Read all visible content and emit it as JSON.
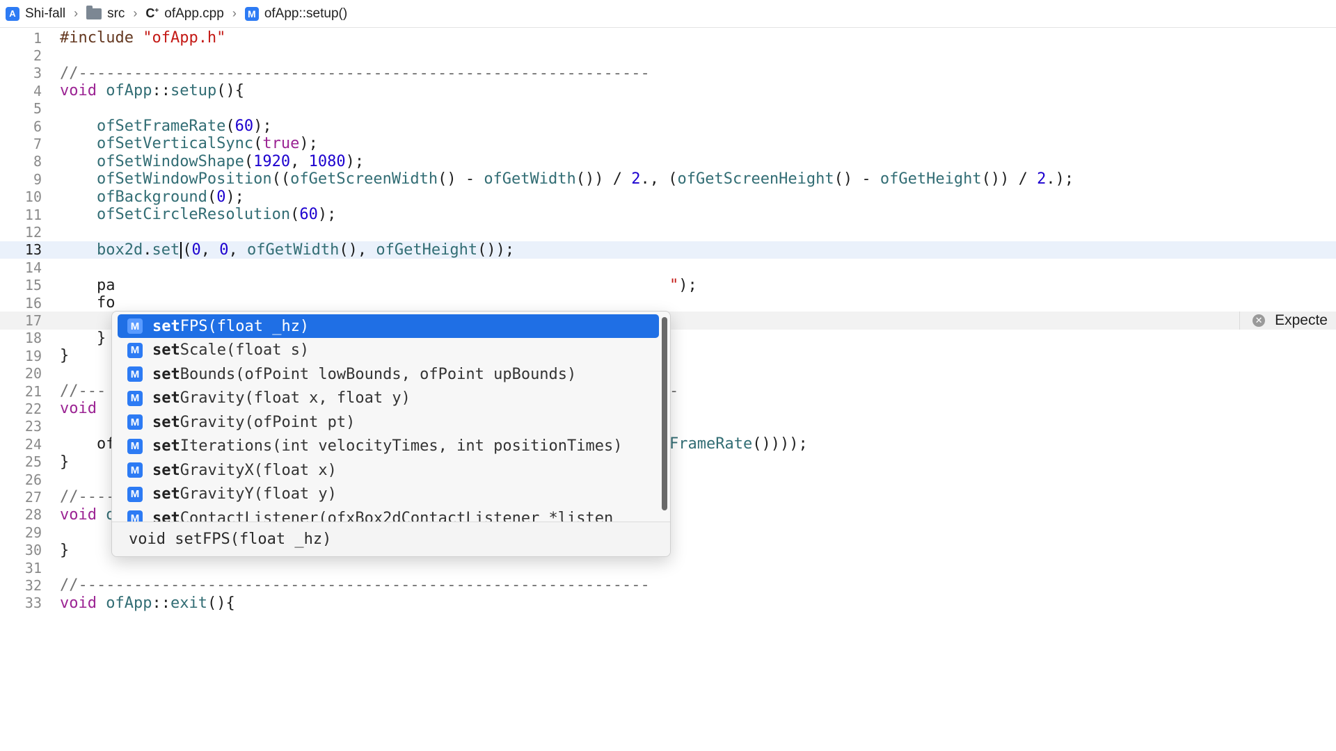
{
  "breadcrumb": {
    "project": "Shi-fall",
    "folder": "src",
    "file": "ofApp.cpp",
    "symbol": "ofApp::setup()"
  },
  "editor": {
    "current_line": 13,
    "lines": [
      {
        "n": "1",
        "text": "#include \"ofApp.h\""
      },
      {
        "n": "2",
        "text": ""
      },
      {
        "n": "3",
        "text": "//--------------------------------------------------------------"
      },
      {
        "n": "4",
        "text": "void ofApp::setup(){"
      },
      {
        "n": "5",
        "text": ""
      },
      {
        "n": "6",
        "text": "    ofSetFrameRate(60);"
      },
      {
        "n": "7",
        "text": "    ofSetVerticalSync(true);"
      },
      {
        "n": "8",
        "text": "    ofSetWindowShape(1920, 1080);"
      },
      {
        "n": "9",
        "text": "    ofSetWindowPosition((ofGetScreenWidth() - ofGetWidth()) / 2., (ofGetScreenHeight() - ofGetHeight()) / 2.);"
      },
      {
        "n": "10",
        "text": "    ofBackground(0);"
      },
      {
        "n": "11",
        "text": "    ofSetCircleResolution(60);"
      },
      {
        "n": "12",
        "text": ""
      },
      {
        "n": "13",
        "text": "    box2d.set(0, 0, ofGetWidth(), ofGetHeight());"
      },
      {
        "n": "14",
        "text": ""
      },
      {
        "n": "15",
        "text": "    pa"
      },
      {
        "n": "16",
        "text": "    fo"
      },
      {
        "n": "17",
        "text": ""
      },
      {
        "n": "18",
        "text": "    }"
      },
      {
        "n": "19",
        "text": "}"
      },
      {
        "n": "20",
        "text": ""
      },
      {
        "n": "21",
        "text": "//---"
      },
      {
        "n": "22",
        "text": "void"
      },
      {
        "n": "23",
        "text": ""
      },
      {
        "n": "24",
        "text": "    of"
      },
      {
        "n": "25",
        "text": "}"
      },
      {
        "n": "26",
        "text": ""
      },
      {
        "n": "27",
        "text": "//--------------------------------------------------------------"
      },
      {
        "n": "28",
        "text": "void ofApp::draw(){"
      },
      {
        "n": "29",
        "text": ""
      },
      {
        "n": "30",
        "text": "}"
      },
      {
        "n": "31",
        "text": ""
      },
      {
        "n": "32",
        "text": "//--------------------------------------------------------------"
      },
      {
        "n": "33",
        "text": "void ofApp::exit(){"
      }
    ],
    "line15_tail": "\");",
    "line21_tail": "-",
    "line24_tail": "FrameRate())));",
    "issue_text": "Expecte"
  },
  "autocomplete": {
    "selected_index": 0,
    "items": [
      {
        "bold": "set",
        "rest": "FPS(float _hz)"
      },
      {
        "bold": "set",
        "rest": "Scale(float s)"
      },
      {
        "bold": "set",
        "rest": "Bounds(ofPoint lowBounds, ofPoint upBounds)"
      },
      {
        "bold": "set",
        "rest": "Gravity(float x, float y)"
      },
      {
        "bold": "set",
        "rest": "Gravity(ofPoint pt)"
      },
      {
        "bold": "set",
        "rest": "Iterations(int velocityTimes, int positionTimes)"
      },
      {
        "bold": "set",
        "rest": "GravityX(float x)"
      },
      {
        "bold": "set",
        "rest": "GravityY(float y)"
      },
      {
        "bold": "set",
        "rest": "ContactListener(ofxBox2dContactListener *listen"
      }
    ],
    "kind_label": "M",
    "footer": "void setFPS(float _hz)"
  }
}
